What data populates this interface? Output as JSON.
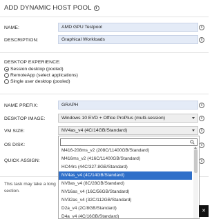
{
  "page": {
    "title": "ADD DYNAMIC HOST POOL"
  },
  "form": {
    "name_label": "NAME:",
    "name_value": "AMD GPU Testpool",
    "description_label": "DESCRIPTION:",
    "description_value": "Graphical Workloads",
    "desktop_experience_label": "DESKTOP EXPERIENCE:",
    "experience_options": [
      {
        "label": "Session desktop (pooled)",
        "checked": true
      },
      {
        "label": "RemoteApp (select applications)",
        "checked": false
      },
      {
        "label": "Single user desktop (pooled)",
        "checked": false
      }
    ],
    "name_prefix_label": "NAME PREFIX:",
    "name_prefix_value": "GRAPH",
    "desktop_image_label": "DESKTOP IMAGE:",
    "desktop_image_value": "Windows 10 EVD + Office ProPlus (multi-session)",
    "vm_size_label": "VM SIZE:",
    "vm_size_value": "NV4as_v4 (4C/14GB/Standard)",
    "os_disk_label": "OS DISK:",
    "quick_assign_label": "QUICK ASSIGN:",
    "task_note_line1": "This task may take a long",
    "task_note_line2": "section."
  },
  "dropdown": {
    "search_value": "",
    "items": [
      {
        "label": "M416-208ms_v2 (208C/11400GB/Standard)",
        "selected": false
      },
      {
        "label": "M416ms_v2 (416C/11400GB/Standard)",
        "selected": false
      },
      {
        "label": "HC44rs (44C/327.8GB/Standard)",
        "selected": false
      },
      {
        "label": "NV4as_v4 (4C/14GB/Standard)",
        "selected": true
      },
      {
        "label": "NV8as_v4 (8C/28GB/Standard)",
        "selected": false
      },
      {
        "label": "NV16as_v4 (16C/56GB/Standard)",
        "selected": false
      },
      {
        "label": "NV32as_v4 (32C/112GB/Standard)",
        "selected": false
      },
      {
        "label": "D2a_v4 (2C/8GB/Standard)",
        "selected": false
      },
      {
        "label": "D4a_v4 (4C/16GB/Standard)",
        "selected": false
      }
    ]
  },
  "colors": {
    "input_fill": "#e4ebf7",
    "selected_item": "#2f6fc9"
  }
}
